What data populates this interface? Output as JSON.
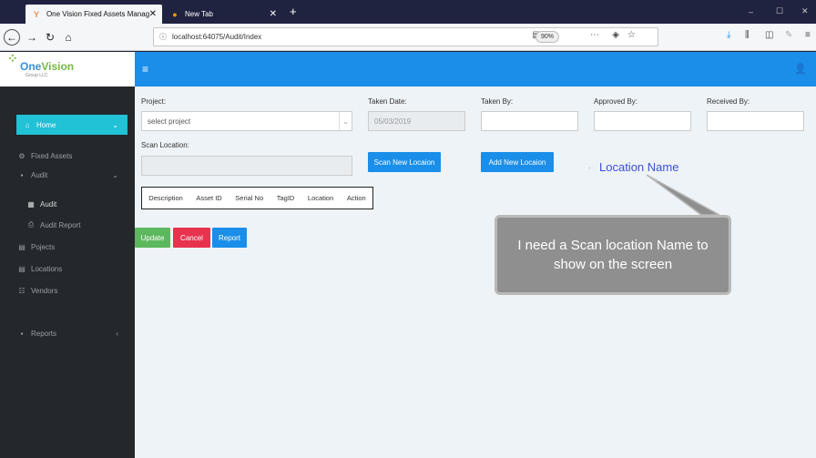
{
  "browser": {
    "tabs": [
      {
        "title": "One Vision Fixed Assets Manag",
        "close": "✕"
      },
      {
        "title": "New Tab",
        "close": "✕"
      }
    ],
    "new_tab": "+",
    "url": "localhost:64075/Audit/Index",
    "zoom": "90%",
    "window_controls": [
      "–",
      "☐",
      "✕"
    ]
  },
  "app": {
    "logo_text_1": "One",
    "logo_text_2": "Vision",
    "logo_sub": "Group LLC"
  },
  "sidebar": {
    "items": [
      {
        "label": "Home",
        "icon": "home-icon"
      },
      {
        "label": "Fixed Assets",
        "icon": "gears-icon"
      },
      {
        "label": "Audit",
        "icon": "card-icon"
      },
      {
        "label": "Audit",
        "icon": "table-icon"
      },
      {
        "label": "Audit Report",
        "icon": "print-icon"
      },
      {
        "label": "Pojects",
        "icon": "file-icon"
      },
      {
        "label": "Locations",
        "icon": "file-icon"
      },
      {
        "label": "Vendors",
        "icon": "list-icon"
      },
      {
        "label": "Reports",
        "icon": "card-icon"
      }
    ]
  },
  "form": {
    "project_label": "Project:",
    "project_placeholder": "select project",
    "taken_date_label": "Taken Date:",
    "taken_date_value": "05/03/2019",
    "taken_by_label": "Taken By:",
    "approved_by_label": "Approved By:",
    "received_by_label": "Received By:",
    "scan_location_label": "Scan Location:",
    "scan_new_location": "Scan New Locaion",
    "add_new_location": "Add New Locaion",
    "location_name_hint": "-"
  },
  "table": {
    "headers": [
      "Description",
      "Asset ID",
      "Serial No",
      "TagID",
      "Location",
      "Action"
    ]
  },
  "actions": {
    "update": "Update",
    "cancel": "Cancel",
    "report": "Report"
  },
  "annotation": {
    "label": "Location Name",
    "callout": "I need a Scan location Name to show on the screen"
  }
}
